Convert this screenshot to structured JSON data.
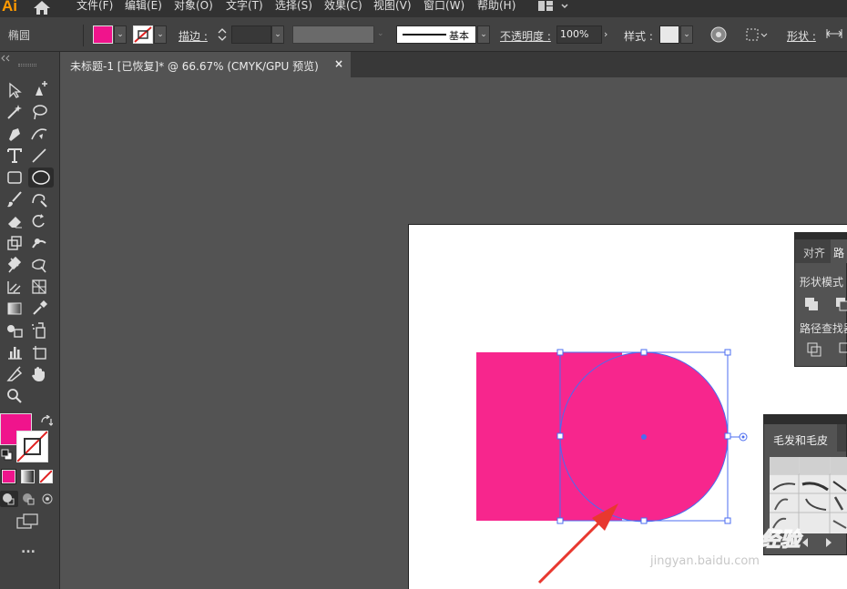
{
  "app": {
    "logo": "Ai"
  },
  "menu": {
    "items": [
      {
        "id": "file",
        "label": "文件(F)"
      },
      {
        "id": "edit",
        "label": "编辑(E)"
      },
      {
        "id": "object",
        "label": "对象(O)"
      },
      {
        "id": "type",
        "label": "文字(T)"
      },
      {
        "id": "select",
        "label": "选择(S)"
      },
      {
        "id": "effect",
        "label": "效果(C)"
      },
      {
        "id": "view",
        "label": "视图(V)"
      },
      {
        "id": "window",
        "label": "窗口(W)"
      },
      {
        "id": "help",
        "label": "帮助(H)"
      }
    ]
  },
  "control": {
    "object_type": "椭圆",
    "stroke_label": "描边 :",
    "stroke_profile_label": "基本",
    "opacity_label": "不透明度 :",
    "opacity_value": "100%",
    "style_label": "样式 :",
    "shape_label": "形状 :",
    "fill_color": "#f0148c"
  },
  "document": {
    "tab_title": "未标题-1 [已恢复]* @ 66.67% (CMYK/GPU 预览)",
    "close": "×"
  },
  "toolbar": {
    "active_tool": "ellipse-tool",
    "fill_color": "#f0148c",
    "more": "..."
  },
  "artwork": {
    "rect_color": "#f7268d",
    "circle_color": "#f7268d",
    "selection_color": "#4b6cf0",
    "arrow_color": "#e8382f"
  },
  "panels": {
    "align": {
      "tabs": [
        "对齐",
        "路"
      ],
      "shape_modes_label": "形状模式",
      "pathfinder_label": "路径查找器"
    },
    "brushes": {
      "tab_label": "毛发和毛皮"
    }
  },
  "watermark": {
    "brand": "Baidu经验",
    "url": "jingyan.baidu.com"
  }
}
